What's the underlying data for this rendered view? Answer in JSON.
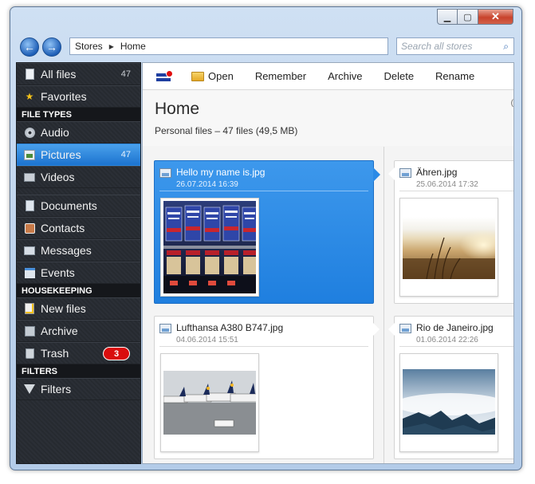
{
  "window": {
    "minimize_glyph": "▁",
    "maximize_glyph": "▢",
    "close_glyph": "✕"
  },
  "nav": {
    "back_glyph": "←",
    "forward_glyph": "→"
  },
  "breadcrumb": {
    "root": "Stores",
    "current": "Home",
    "separator_glyph": "▶"
  },
  "search": {
    "placeholder": "Search all stores",
    "icon": "search-icon"
  },
  "sidebar": {
    "sections": [
      {
        "header": "",
        "items": [
          {
            "label": "All files",
            "count": "47",
            "icon": "file-icon"
          },
          {
            "label": "Favorites",
            "count": "",
            "icon": "star-icon"
          }
        ]
      },
      {
        "header": "FILE TYPES",
        "items": [
          {
            "label": "Audio",
            "count": "",
            "icon": "disc-icon"
          },
          {
            "label": "Pictures",
            "count": "47",
            "icon": "picture-icon",
            "active": true
          },
          {
            "label": "Videos",
            "count": "",
            "icon": "video-icon"
          }
        ]
      },
      {
        "header": "",
        "items": [
          {
            "label": "Documents",
            "count": "",
            "icon": "document-icon"
          },
          {
            "label": "Contacts",
            "count": "",
            "icon": "contact-icon"
          },
          {
            "label": "Messages",
            "count": "",
            "icon": "message-icon"
          },
          {
            "label": "Events",
            "count": "",
            "icon": "calendar-icon"
          }
        ]
      },
      {
        "header": "HOUSEKEEPING",
        "items": [
          {
            "label": "New files",
            "count": "",
            "icon": "new-file-icon"
          },
          {
            "label": "Archive",
            "count": "",
            "icon": "archive-icon"
          },
          {
            "label": "Trash",
            "count": "",
            "badge": "3",
            "icon": "trash-icon"
          }
        ]
      },
      {
        "header": "FILTERS",
        "items": [
          {
            "label": "Filters",
            "count": "",
            "icon": "filter-icon"
          }
        ]
      }
    ]
  },
  "toolbar": {
    "open_label": "Open",
    "remember_label": "Remember",
    "archive_label": "Archive",
    "delete_label": "Delete",
    "rename_label": "Rename",
    "logo_icon": "app-logo-icon"
  },
  "header": {
    "title": "Home",
    "subtitle": "Personal files – 47 files (49,5 MB)",
    "edge_char": "("
  },
  "files": [
    {
      "name": "Hello my name is.jpg",
      "date": "26.07.2014 16:39",
      "selected": true,
      "thumbnail": "vending-machine-photo"
    },
    {
      "name": "Ähren.jpg",
      "date": "25.06.2014 17:32",
      "selected": false,
      "thumbnail": "wheat-sunset-photo"
    },
    {
      "name": "Lufthansa A380 B747.jpg",
      "date": "04.06.2014 15:51",
      "selected": false,
      "thumbnail": "airport-planes-photo"
    },
    {
      "name": "Rio de Janeiro.jpg",
      "date": "01.06.2014 22:26",
      "selected": false,
      "thumbnail": "rio-landscape-photo"
    }
  ],
  "colors": {
    "accent": "#1f7fdf",
    "sidebar_bg": "#2b2f36",
    "badge": "#d90d0d"
  }
}
